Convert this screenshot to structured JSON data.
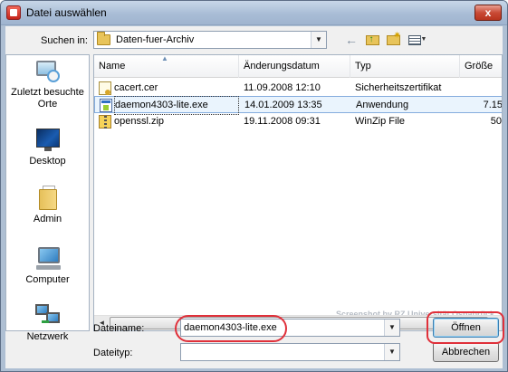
{
  "window": {
    "title": "Datei auswählen",
    "close_glyph": "x"
  },
  "toolbar": {
    "lookin_label": "Suchen in:",
    "lookin_value": "Daten-fuer-Archiv",
    "back_glyph": "←",
    "view_menu_glyph": "▼",
    "dropdown_glyph": "▼"
  },
  "places": [
    {
      "label": "Zuletzt besuchte Orte",
      "icon": "recent-places-icon"
    },
    {
      "label": "Desktop",
      "icon": "desktop-icon"
    },
    {
      "label": "Admin",
      "icon": "user-folder-icon"
    },
    {
      "label": "Computer",
      "icon": "computer-icon"
    },
    {
      "label": "Netzwerk",
      "icon": "network-icon"
    }
  ],
  "filelist": {
    "columns": {
      "name": "Name",
      "date": "Änderungsdatum",
      "type": "Typ",
      "size": "Größe"
    },
    "sort_glyph": "▲",
    "rows": [
      {
        "name": "cacert.cer",
        "date": "11.09.2008 12:10",
        "type": "Sicherheitszertifikat",
        "size": "",
        "icon": "certificate-file-icon"
      },
      {
        "name": "daemon4303-lite.exe",
        "date": "14.01.2009 13:35",
        "type": "Anwendung",
        "size": "7.15",
        "icon": "executable-file-icon"
      },
      {
        "name": "openssl.zip",
        "date": "19.11.2008 09:31",
        "type": "WinZip File",
        "size": "50",
        "icon": "zip-file-icon"
      }
    ],
    "selected_row": 1,
    "scroll_left_glyph": "◄",
    "scroll_right_glyph": "►",
    "scroll_grip": "|||",
    "watermark": "Screenshot by RZ Universität Osnabrück"
  },
  "form": {
    "filename_label": "Dateiname:",
    "filename_value": "daemon4303-lite.exe",
    "filetype_label": "Dateityp:",
    "filetype_value": "",
    "open_button": "Öffnen",
    "cancel_button": "Abbrechen"
  },
  "colors": {
    "highlight_annotation": "#e0303a",
    "selection_background": "#eaf4fd"
  }
}
